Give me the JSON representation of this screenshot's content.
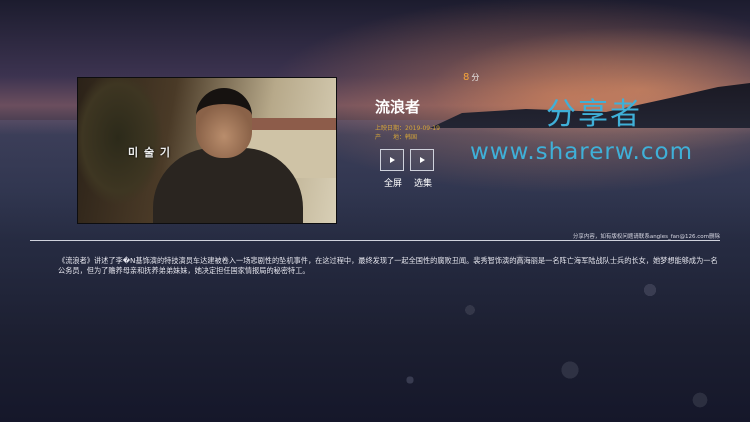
{
  "movie": {
    "title": "流浪者",
    "poster_caption": "미 술 기",
    "score_value": "8",
    "score_unit": "分",
    "release_label": "上映日期：",
    "release_date": "2019-09-19",
    "region_label": "产　　地：",
    "region": "韩国",
    "description": "《流浪者》讲述了李�N基饰演的特技演员车达建被卷入一场悲剧性的坠机事件，在这过程中，最终发现了一起全国性的腐败丑闻。裴秀智饰演的高海丽是一名阵亡海军陆战队士兵的长女，她梦想能够成为一名公务员，但为了赡养母亲和抚养弟弟妹妹，她决定担任国家情报局的秘密特工。"
  },
  "actions": {
    "full_label": "全屏",
    "episodes_label": "选集"
  },
  "watermark": {
    "cn": "分享者",
    "url": "www.sharerw.com"
  },
  "notice": "分享内容，如有版权问题请联系angles_fan@126.com删除",
  "colors": {
    "accent": "#f5a43a",
    "watermark": "#3fb0d8",
    "meta": "#d4a43a"
  },
  "icons": {
    "play": "play-icon"
  }
}
